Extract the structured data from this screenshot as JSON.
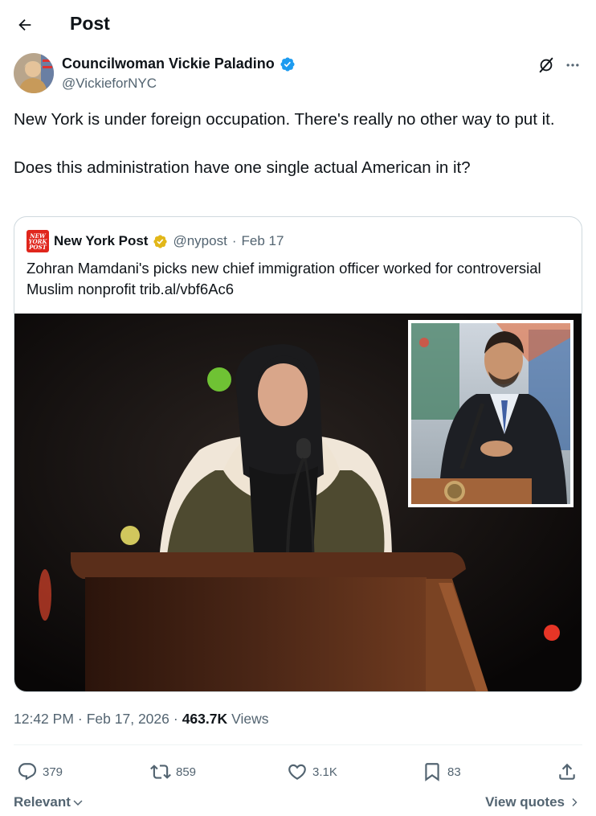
{
  "header": {
    "title": "Post",
    "back_icon": "arrow-left-icon"
  },
  "author": {
    "name": "Councilwoman Vickie Paladino",
    "handle": "@VickieforNYC",
    "verified_color": "#1d9bf0"
  },
  "tweet": {
    "paragraph1": "New York is under foreign occupation. There's really no other way to put it.",
    "paragraph2": "Does this administration have one single actual American in it?"
  },
  "quote": {
    "logo_lines": [
      "NEW",
      "YORK",
      "POST"
    ],
    "name": "New York Post",
    "handle": "@nypost",
    "separator": "·",
    "date": "Feb 17",
    "text": "Zohran Mamdani's picks new chief immigration officer worked for controversial Muslim nonprofit trib.al/vbf6Ac6",
    "verified_color": "#e2b719"
  },
  "meta": {
    "time": "12:42 PM",
    "sep1": "·",
    "date": "Feb 17, 2026",
    "sep2": "·",
    "views_count": "463.7K",
    "views_label": "Views"
  },
  "actions": {
    "replies": "379",
    "reposts": "859",
    "likes": "3.1K",
    "bookmarks": "83"
  },
  "footer": {
    "relevant_label": "Relevant",
    "view_quotes_label": "View quotes"
  },
  "colors": {
    "text_primary": "#0f1419",
    "text_secondary": "#536471",
    "border": "#cfd9de",
    "brand_blue": "#1d9bf0"
  }
}
